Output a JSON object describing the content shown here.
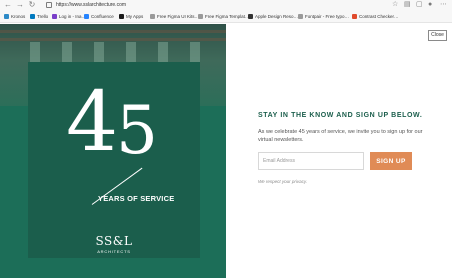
{
  "browser": {
    "url": "https://www.sslarchitecture.com"
  },
  "bookmarks": [
    {
      "label": "Kronos",
      "icon": "kronos-icon",
      "color": "#2d8ac7"
    },
    {
      "label": "Trello",
      "icon": "trello-icon",
      "color": "#0079bf"
    },
    {
      "label": "Log in - Ina…",
      "icon": "login-icon",
      "color": "#7a3ec9"
    },
    {
      "label": "Confluence",
      "icon": "confluence-icon",
      "color": "#2684ff"
    },
    {
      "label": "My Apps",
      "icon": "apps-icon",
      "color": "#1a1a1a"
    },
    {
      "label": "Free Figma UI Kits…",
      "icon": "page-icon",
      "color": "#9a9a9a"
    },
    {
      "label": "Free Figma Templat…",
      "icon": "page-icon",
      "color": "#9a9a9a"
    },
    {
      "label": "Apple Design Reso…",
      "icon": "apple-icon",
      "color": "#333333"
    },
    {
      "label": "Fontpair - Free typo…",
      "icon": "page-icon",
      "color": "#9a9a9a"
    },
    {
      "label": "Contrast Checker…",
      "icon": "contrast-icon",
      "color": "#e04a2c"
    }
  ],
  "hero": {
    "digit_4": "4",
    "digit_5": "5",
    "years_text": "YEARS OF SERVICE",
    "logo_main": "SS&L",
    "logo_sub": "ARCHITECTS"
  },
  "modal": {
    "close_label": "Close",
    "headline": "STAY IN THE KNOW AND SIGN UP BELOW.",
    "body_line1": "As we celebrate 45 years of service, we invite you to sign up for our",
    "body_line2": "virtual newsletters.",
    "email_placeholder": "Email Address",
    "signup_label": "SIGN UP",
    "privacy_text": "We respect your privacy."
  },
  "colors": {
    "brand_green": "#1b5e4c",
    "accent_orange": "#e08b56"
  }
}
